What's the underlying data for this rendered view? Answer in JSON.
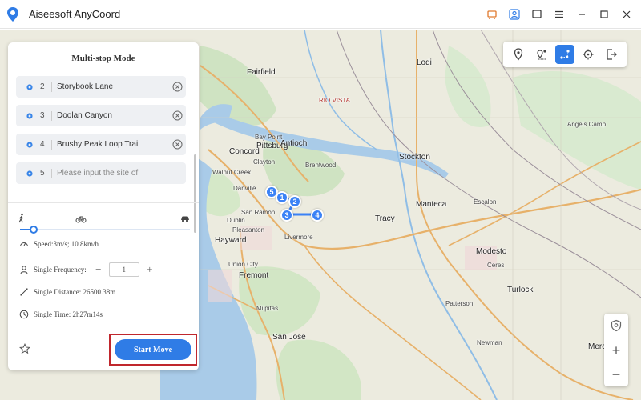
{
  "app": {
    "title": "Aiseesoft AnyCoord"
  },
  "panel": {
    "title": "Multi-stop Mode",
    "stops": [
      {
        "index": "2",
        "label": "Storybook Lane",
        "placeholder": false
      },
      {
        "index": "3",
        "label": "Doolan Canyon",
        "placeholder": false
      },
      {
        "index": "4",
        "label": "Brushy Peak Loop Trai",
        "placeholder": false
      },
      {
        "index": "5",
        "label": "Please input the site of",
        "placeholder": true
      }
    ],
    "speed_slider_level": 0.08,
    "speed_text": "Speed:3m/s; 10.8km/h",
    "frequency_label": "Single Frequency:",
    "frequency_minus": "−",
    "frequency_value": "1",
    "frequency_plus": "+",
    "distance_text": "Single Distance: 26500.38m",
    "time_text": "Single Time: 2h27m14s",
    "start_button": "Start Move"
  },
  "map": {
    "places": {
      "fairfield": "Fairfield",
      "rio_vista": "RIO VISTA",
      "concord": "Concord",
      "pittsburg": "Pittsburg",
      "antioch": "Antioch",
      "bay_point": "Bay Point",
      "brentwood": "Brentwood",
      "walnut_creek": "Walnut Creek",
      "clayton": "Clayton",
      "danville": "Danville",
      "san_ramon": "San Ramon",
      "dublin": "Dublin",
      "pleasanton": "Pleasanton",
      "livermore": "Livermore",
      "hayward": "Hayward",
      "union_city": "Union City",
      "fremont": "Fremont",
      "milpitas": "Milpitas",
      "san_jose": "San Jose",
      "tracy": "Tracy",
      "stockton": "Stockton",
      "manteca": "Manteca",
      "escalon": "Escalon",
      "modesto": "Modesto",
      "ceres": "Ceres",
      "turlock": "Turlock",
      "newman": "Newman",
      "patterson": "Patterson",
      "angels_camp": "Angels Camp",
      "lodi": "Lodi",
      "merced": "Merce"
    },
    "route_pins": [
      "5",
      "1",
      "2",
      "3",
      "4"
    ],
    "zoom_in": "+",
    "zoom_out": "−"
  },
  "icons": {
    "app_logo": "location-pin-icon",
    "tools": [
      "teleport-pin-icon",
      "one-stop-icon",
      "multi-stop-icon",
      "joystick-icon",
      "exit-icon"
    ]
  },
  "colors": {
    "accent": "#2f7ce6",
    "highlight": "#c0272d",
    "pin": "#3b82f6"
  }
}
